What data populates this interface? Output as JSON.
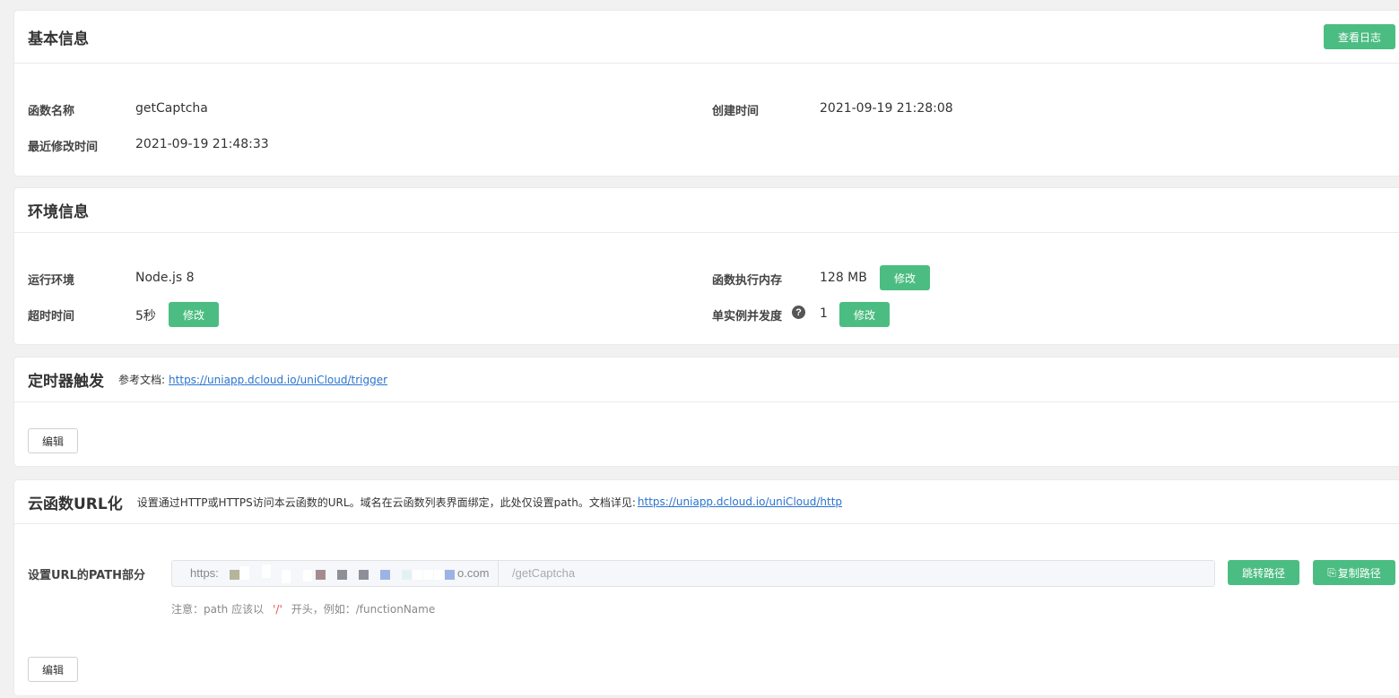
{
  "basic": {
    "title": "基本信息",
    "view_log_button": "查看日志",
    "fn_name_label": "函数名称",
    "fn_name_value": "getCaptcha",
    "created_label": "创建时间",
    "created_value": "2021-09-19 21:28:08",
    "modified_label": "最近修改时间",
    "modified_value": "2021-09-19 21:48:33"
  },
  "env": {
    "title": "环境信息",
    "runtime_label": "运行环境",
    "runtime_value": "Node.js 8",
    "memory_label": "函数执行内存",
    "memory_value": "128 MB",
    "memory_edit": "修改",
    "timeout_label": "超时时间",
    "timeout_value": "5秒",
    "timeout_edit": "修改",
    "concurrency_label": "单实例并发度",
    "concurrency_help": "?",
    "concurrency_value": "1",
    "concurrency_edit": "修改"
  },
  "timer": {
    "title": "定时器触发",
    "doc_prefix": "参考文档:",
    "doc_link": "https://uniapp.dcloud.io/uniCloud/trigger",
    "edit_button": "编辑"
  },
  "url": {
    "title": "云函数URL化",
    "desc_prefix": "设置通过HTTP或HTTPS访问本云函数的URL。域名在云函数列表界面绑定，此处仅设置path。文档详见:",
    "doc_link": "https://uniapp.dcloud.io/uniCloud/http",
    "path_label": "设置URL的PATH部分",
    "prefix_start": "https:",
    "prefix_end": "o.com",
    "path_value": "/getCaptcha",
    "jump_button": "跳转路径",
    "copy_button": "复制路径",
    "note_prefix": "注意：path 应该以",
    "note_slash": "'/'",
    "note_suffix": "开头，例如：/functionName",
    "edit_button": "编辑"
  },
  "colors": {
    "accent": "#4cbd82",
    "link": "#2a73cf",
    "background": "#f1f1f1"
  }
}
